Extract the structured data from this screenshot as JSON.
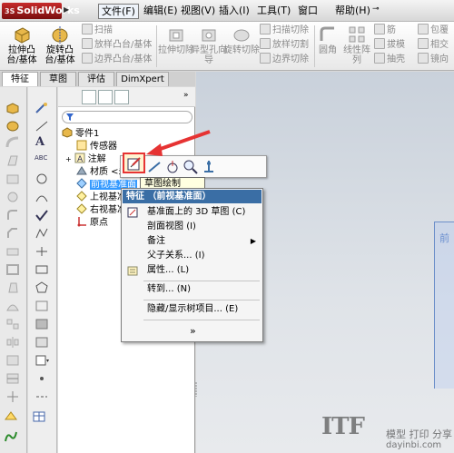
{
  "app": {
    "logo": "SolidWorks",
    "logo_prefix": "3S"
  },
  "menu": {
    "file": "文件(F)",
    "edit": "编辑(E)",
    "view": "视图(V)",
    "insert": "插入(I)",
    "tools": "工具(T)",
    "window": "窗口",
    "help": "帮助(H)"
  },
  "commands": {
    "extrude_boss": "拉伸凸台/基体",
    "revolve_boss": "旋转凸台/基体",
    "sweep_boss": "扫描",
    "loft_boss": "放样凸台/基体",
    "boundary_boss": "边界凸台/基体",
    "extrude_cut": "拉伸切除",
    "hole_wizard": "异型孔向导",
    "revolve_cut": "旋转切除",
    "sweep_cut": "扫描切除",
    "loft_cut": "放样切割",
    "boundary_cut": "边界切除",
    "fillet": "圆角",
    "linear_pattern": "线性阵列",
    "rib": "筋",
    "draft": "拔模",
    "shell": "抽壳",
    "wrap": "包覆",
    "intersect": "相交",
    "mirror": "镜向"
  },
  "tabs": [
    "特征",
    "草图",
    "评估",
    "DimXpert"
  ],
  "tree": {
    "root": "零件1",
    "items": [
      {
        "label": "传感器"
      },
      {
        "label": "注解"
      },
      {
        "label": "材质 <未指定>"
      },
      {
        "label": "前视基准面",
        "selected": true
      },
      {
        "label": "上视基准面"
      },
      {
        "label": "右视基准面"
      },
      {
        "label": "原点"
      }
    ]
  },
  "context_toolbar": {
    "tooltip": "草图绘制"
  },
  "context_menu": {
    "header": "特征 （前视基准面）",
    "items": [
      {
        "label": "基准面上的 3D 草图",
        "shortcut": "(C)"
      },
      {
        "label": "剖面视图",
        "shortcut": "(I)"
      },
      {
        "label": "备注",
        "submenu": true
      },
      {
        "label": "父子关系...",
        "shortcut": "(I)"
      },
      {
        "label": "属性...",
        "shortcut": "(L)"
      },
      {
        "label": "转到...",
        "shortcut": "(N)"
      },
      {
        "label": "隐藏/显示树项目...",
        "shortcut": "(E)"
      }
    ],
    "more": "»"
  },
  "graphics": {
    "plane_label": "前"
  },
  "watermark": {
    "logo": "ITF",
    "name": "模型 打印 分享",
    "url": "dayinbi.com"
  },
  "colors": {
    "highlight_red": "#e63333",
    "menu_header": "#3a6ea5",
    "selection": "#3399ff"
  }
}
